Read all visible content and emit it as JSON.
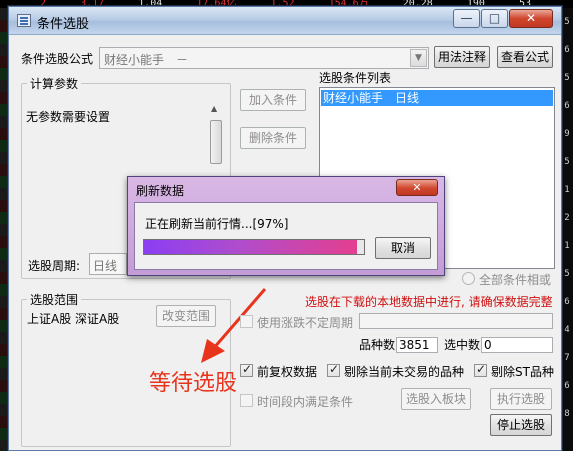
{
  "background": {
    "ticker": [
      "2",
      "3.17",
      "1.04",
      "17.64亿",
      "1.52",
      "154.6万",
      "20.28",
      "190",
      "53"
    ],
    "right_edge": [
      "5",
      "6",
      "5",
      "6",
      "9",
      "5",
      "1",
      "2",
      "1",
      "5",
      "6",
      "4",
      "7",
      "6",
      "8"
    ]
  },
  "window": {
    "title": "条件选股",
    "controls": {
      "minimize": "—",
      "maximize": "□",
      "close": "✕"
    }
  },
  "formula": {
    "label": "条件选股公式",
    "value": "财经小能手　－",
    "usage_button": "用法注释",
    "view_button": "查看公式"
  },
  "params": {
    "group_title": "计算参数",
    "text": "无参数需要设置"
  },
  "buttons": {
    "add_condition": "加入条件",
    "delete_condition": "删除条件",
    "change_range": "改变范围",
    "add_to_block": "选股入板块",
    "run_selection": "执行选股",
    "stop_selection": "停止选股"
  },
  "conditions": {
    "title": "选股条件列表",
    "items": [
      "财经小能手　日线"
    ]
  },
  "period": {
    "label": "选股周期:",
    "value": "日线"
  },
  "range": {
    "group_title": "选股范围",
    "value": "上证A股 深证A股"
  },
  "match_option": "全部条件相或",
  "notice": "选股在下载的本地数据中进行, 请确保数据完整",
  "uncertain_period": "使用涨跌不定周期",
  "counts": {
    "variety_label": "品种数",
    "variety_value": "3851",
    "selected_label": "选中数",
    "selected_value": "0"
  },
  "options": {
    "forward_adjusted": "前复权数据",
    "exclude_untraded": "剔除当前未交易的品种",
    "exclude_st": "剔除ST品种",
    "time_period": "时间段内满足条件"
  },
  "annotation": "等待选股",
  "dialog": {
    "title": "刷新数据",
    "message": "正在刷新当前行情...[97%]",
    "progress": 0.97,
    "cancel_button": "取消",
    "close": "✕"
  },
  "colors": {
    "accent_red": "#e8341c",
    "selection": "#3399ff"
  }
}
